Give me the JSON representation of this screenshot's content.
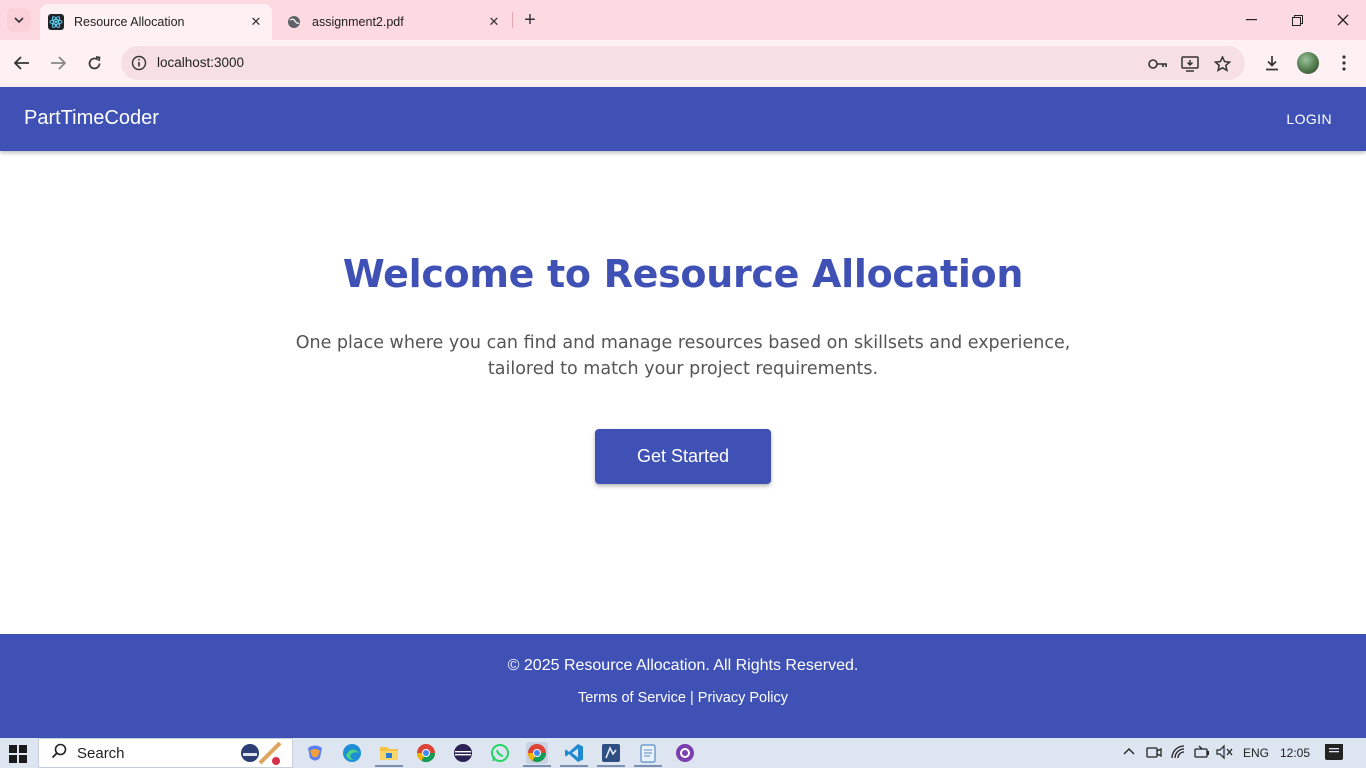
{
  "browser": {
    "tabs": [
      {
        "title": "Resource Allocation",
        "active": true
      },
      {
        "title": "assignment2.pdf",
        "active": false
      }
    ],
    "url": "localhost:3000",
    "window_controls": [
      "minimize-icon",
      "restore-icon",
      "close-icon"
    ]
  },
  "app": {
    "brand": "PartTimeCoder",
    "login_label": "LOGIN",
    "hero": {
      "title": "Welcome to Resource Allocation",
      "description_line1": "One place where you can find and manage resources based on skillsets and experience,",
      "description_line2": "tailored to match your project requirements.",
      "cta_label": "Get Started"
    },
    "footer": {
      "copyright": "© 2025 Resource Allocation. All Rights Reserved.",
      "terms": "Terms of Service",
      "separator": "|",
      "privacy": "Privacy Policy"
    },
    "colors": {
      "primary": "#3f51b5",
      "text_muted": "#555555"
    }
  },
  "taskbar": {
    "search_label": "Search",
    "language": "ENG",
    "time": "12:05",
    "apps": [
      "copilot-icon",
      "edge-icon",
      "file-explorer-icon",
      "chrome-icon",
      "eclipse-icon",
      "whatsapp-icon",
      "chrome-active-icon",
      "vscode-icon",
      "ssms-icon",
      "notepad-icon",
      "github-desktop-icon"
    ]
  }
}
